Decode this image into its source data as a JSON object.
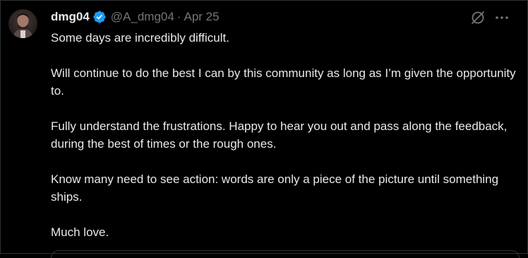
{
  "post": {
    "display_name": "dmg04",
    "handle": "@A_dmg04",
    "separator": "·",
    "date": "Apr 25",
    "verified_icon": "verified-badge-icon",
    "verified_color": "#1d9bf0",
    "paragraphs": [
      "Some days are incredibly difficult.",
      "Will continue to do the best I can by this community as long as I’m given the opportunity to.",
      "Fully understand the frustrations. Happy to hear you out and pass along the feedback, during the best of times or the rough ones.",
      "Know many need to see action: words are only a piece of the picture until something ships.",
      "Much love."
    ]
  },
  "actions": {
    "grok_icon": "grok-icon",
    "more_icon": "more-icon"
  },
  "colors": {
    "background": "#000000",
    "text": "#e7e9ea",
    "secondary_text": "#71767b",
    "border": "#2f3336"
  }
}
